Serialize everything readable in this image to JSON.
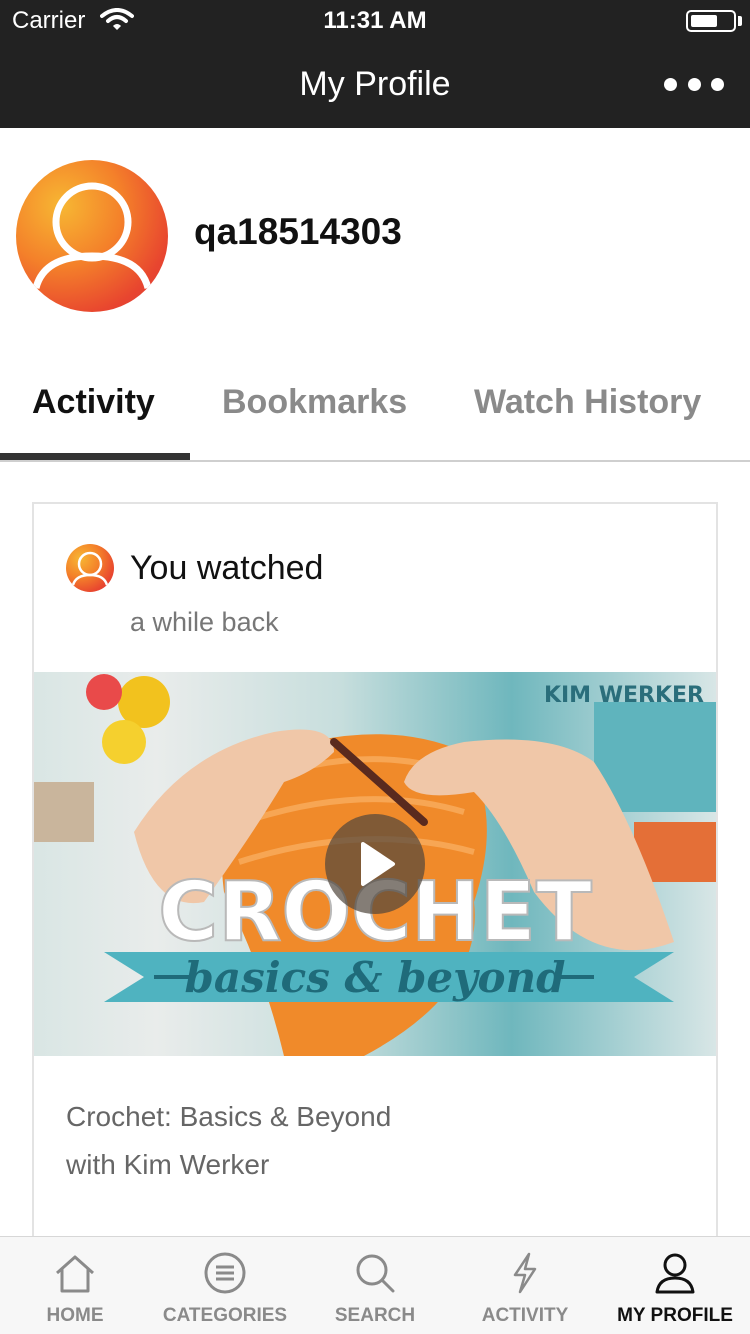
{
  "status_bar": {
    "carrier": "Carrier",
    "time": "11:31 AM"
  },
  "nav": {
    "title": "My Profile",
    "more_icon": "more-horizontal-icon"
  },
  "profile": {
    "username": "qa18514303",
    "avatar_icon": "user-avatar-icon"
  },
  "tabs": [
    {
      "label": "Activity",
      "active": true
    },
    {
      "label": "Bookmarks",
      "active": false
    },
    {
      "label": "Watch History",
      "active": false
    }
  ],
  "activity_card": {
    "headline": "You watched",
    "time_ago": "a while back",
    "video": {
      "brand": "KIM WERKER",
      "title_big": "CROCHET",
      "title_script": "basics & beyond",
      "play_icon": "play-icon"
    },
    "course_title": "Crochet: Basics & Beyond",
    "course_author": "with Kim Werker"
  },
  "tabbar": [
    {
      "label": "HOME",
      "icon": "home-icon",
      "active": false
    },
    {
      "label": "CATEGORIES",
      "icon": "categories-icon",
      "active": false
    },
    {
      "label": "SEARCH",
      "icon": "search-icon",
      "active": false
    },
    {
      "label": "ACTIVITY",
      "icon": "lightning-icon",
      "active": false
    },
    {
      "label": "MY PROFILE",
      "icon": "profile-icon",
      "active": true
    }
  ],
  "colors": {
    "nav_background": "#222222",
    "active_text": "#111111",
    "inactive_text": "#8a8a8a",
    "avatar_orange": "#f4812a",
    "avatar_red": "#e8452f",
    "banner_teal": "#4fb3c0"
  }
}
